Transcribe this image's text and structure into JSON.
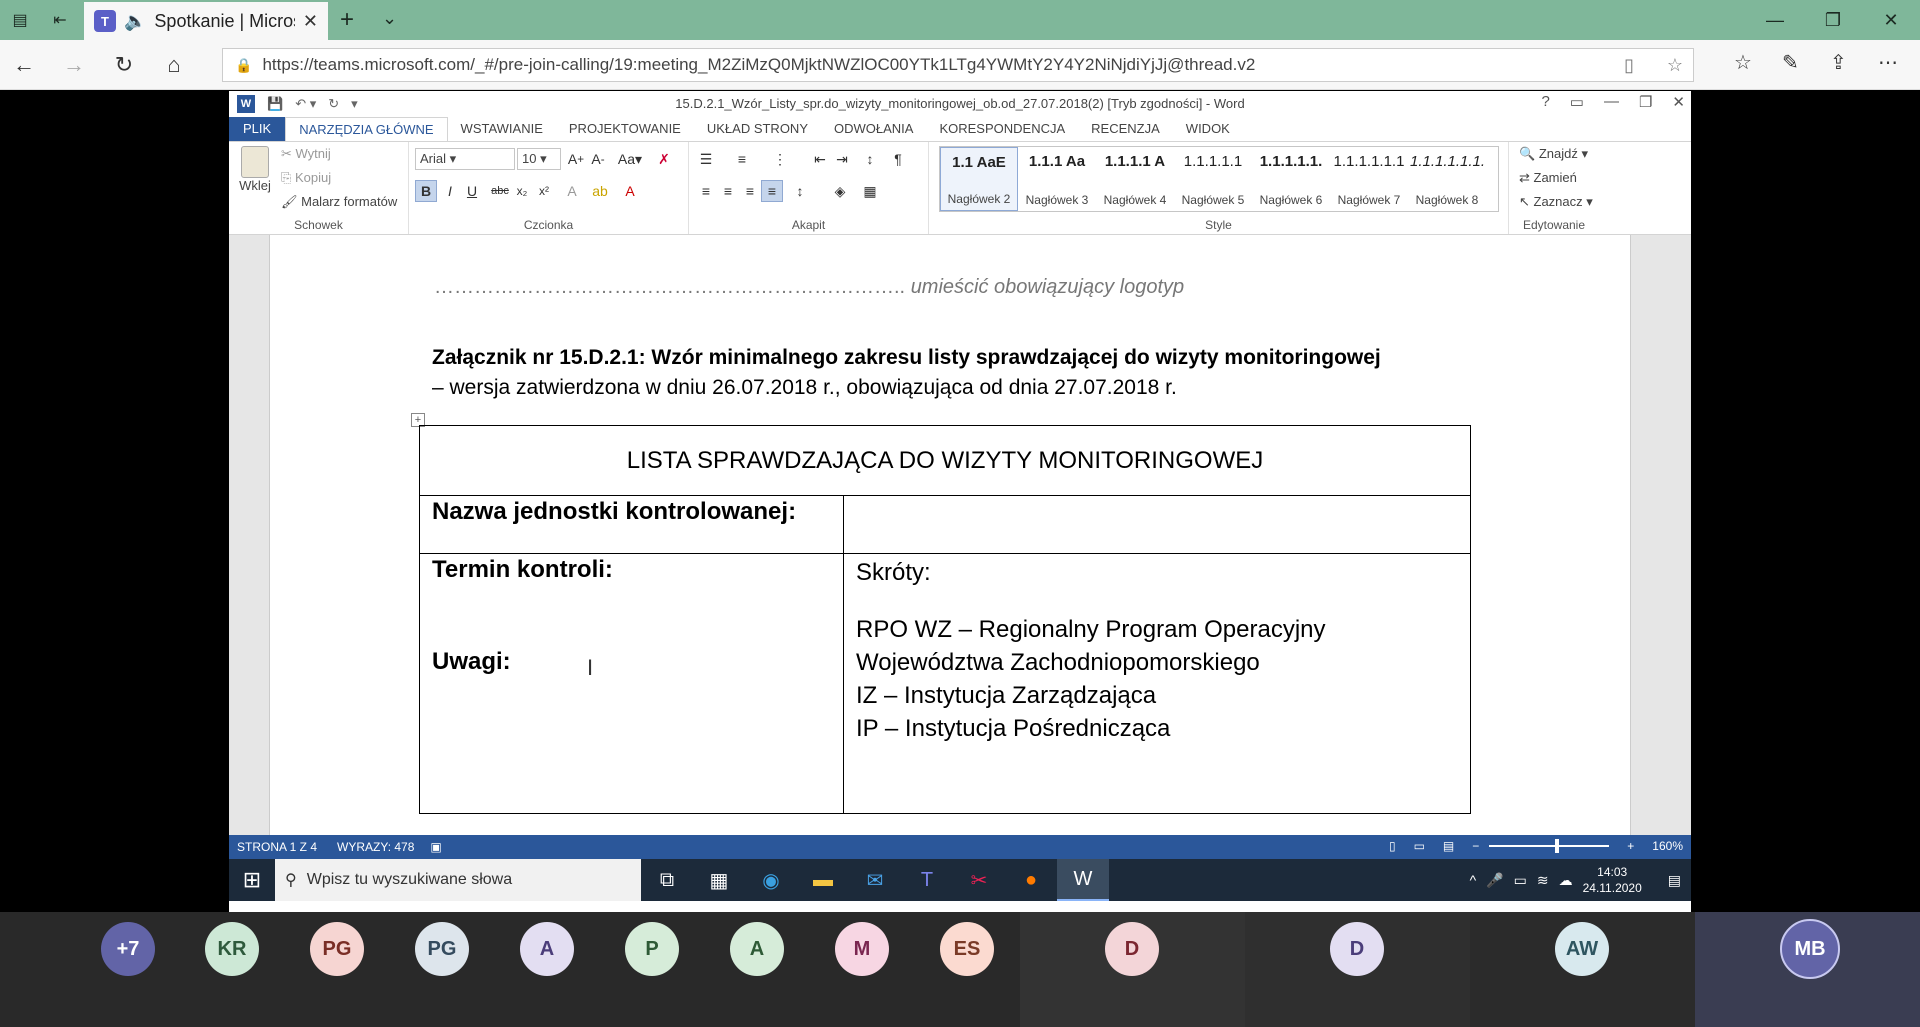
{
  "browser": {
    "tab_title": "Spotkanie | Microsc",
    "url": "https://teams.microsoft.com/_#/pre-join-calling/19:meeting_M2ZiMzQ0MjktNWZlOC00YTk1LTg4YWMtY2Y4Y2NiNjdiYjJj@thread.v2"
  },
  "word": {
    "doc_title": "15.D.2.1_Wzór_Listy_spr.do_wizyty_monitoringowej_ob.od_27.07.2018(2) [Tryb zgodności] - Word",
    "tabs": [
      "PLIK",
      "NARZĘDZIA GŁÓWNE",
      "WSTAWIANIE",
      "PROJEKTOWANIE",
      "UKŁAD STRONY",
      "ODWOŁANIA",
      "KORESPONDENCJA",
      "RECENZJA",
      "WIDOK"
    ],
    "clipboard": {
      "paste": "Wklej",
      "cut": "Wytnij",
      "copy": "Kopiuj",
      "painter": "Malarz formatów",
      "group": "Schowek"
    },
    "font": {
      "name": "Arial",
      "size": "10",
      "group": "Czcionka",
      "case_btn": "Aa"
    },
    "paragraph_group": "Akapit",
    "styles": [
      {
        "preview": "1.1  AaE",
        "label": "Nagłówek 2"
      },
      {
        "preview": "1.1.1  Aa",
        "label": "Nagłówek 3"
      },
      {
        "preview": "1.1.1.1  A",
        "label": "Nagłówek 4"
      },
      {
        "preview": "1.1.1.1.1",
        "label": "Nagłówek 5"
      },
      {
        "preview": "1.1.1.1.1.",
        "label": "Nagłówek 6"
      },
      {
        "preview": "1.1.1.1.1.1",
        "label": "Nagłówek 7"
      },
      {
        "preview": "1.1.1.1.1.1.",
        "label": "Nagłówek 8"
      }
    ],
    "styles_group": "Style",
    "editing": {
      "find": "Znajdź",
      "replace": "Zamień",
      "select": "Zaznacz",
      "group": "Edytowanie"
    },
    "document": {
      "logo_dots": "……………………………………………………………..",
      "logo_text": "umieścić obowiązujący logotyp",
      "heading_bold": "Załącznik nr 15.D.2.1: Wzór minimalnego zakresu listy sprawdzającej do wizyty monitoringowej",
      "heading_rest": "– wersja zatwierdzona w dniu 26.07.2018 r., obowiązująca od dnia 27.07.2018 r.",
      "table_title": "LISTA SPRAWDZAJĄCA DO WIZYTY MONITORINGOWEJ",
      "unit_label": "Nazwa jednostki kontrolowanej:",
      "term_label": "Termin kontroli:",
      "notes_label": "Uwagi:",
      "abbr_title": "Skróty:",
      "abbr_lines": [
        "RPO WZ – Regionalny Program Operacyjny",
        "Województwa Zachodniopomorskiego",
        "IZ – Instytucja Zarządzająca",
        "IP – Instytucja Pośrednicząca"
      ]
    },
    "status": {
      "page": "STRONA 1 Z 4",
      "words": "WYRAZY: 478",
      "zoom": "160%"
    }
  },
  "taskbar": {
    "search_placeholder": "Wpisz tu wyszukiwane słowa",
    "time": "14:03",
    "date": "24.11.2020"
  },
  "participants": [
    {
      "initials": "+7",
      "color": "#6264a7",
      "text": "#ffffff"
    },
    {
      "initials": "KR",
      "color": "#cde8d6",
      "text": "#2e5a3c"
    },
    {
      "initials": "PG",
      "color": "#f6d5d2",
      "text": "#7a2e26"
    },
    {
      "initials": "PG",
      "color": "#dde5ec",
      "text": "#344b5e"
    },
    {
      "initials": "A",
      "color": "#e3def2",
      "text": "#4b3d7a"
    },
    {
      "initials": "P",
      "color": "#d6ecd9",
      "text": "#2e5a36"
    },
    {
      "initials": "A",
      "color": "#d6ecd9",
      "text": "#2e5a36"
    },
    {
      "initials": "M",
      "color": "#f7d6e3",
      "text": "#7a2650"
    },
    {
      "initials": "ES",
      "color": "#fbdad0",
      "text": "#7a3a26"
    },
    {
      "initials": "D",
      "color": "#f3d5d8",
      "text": "#7a2630"
    },
    {
      "initials": "D",
      "color": "#e3def2",
      "text": "#4b3d7a"
    },
    {
      "initials": "AW",
      "color": "#d8e9ee",
      "text": "#2e5560"
    },
    {
      "initials": "MB",
      "color": "#6264a7",
      "text": "#ffffff"
    }
  ]
}
